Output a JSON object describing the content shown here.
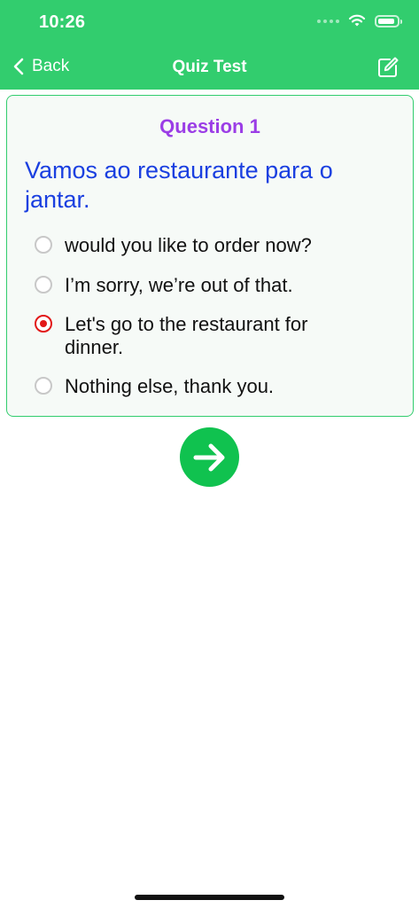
{
  "status_bar": {
    "time": "10:26"
  },
  "nav": {
    "back_label": "Back",
    "title": "Quiz Test"
  },
  "quiz": {
    "question_number": "Question 1",
    "question_text": "Vamos ao restaurante para o jantar.",
    "options": [
      {
        "label": "would you like to order now?",
        "selected": false
      },
      {
        "label": "I’m sorry, we’re out of that.",
        "selected": false
      },
      {
        "label": "Let's go to the restaurant for dinner.",
        "selected": true
      },
      {
        "label": "Nothing else, thank you.",
        "selected": false
      }
    ]
  },
  "colors": {
    "header_bg": "#32CD6E",
    "question_number": "#9B3DE6",
    "question_text": "#1A3FE0",
    "selected_radio": "#E21818",
    "next_button": "#10C24F"
  },
  "icons": {
    "back": "chevron-left-icon",
    "edit": "edit-icon",
    "next": "arrow-right-icon",
    "wifi": "wifi-icon",
    "battery": "battery-icon"
  }
}
